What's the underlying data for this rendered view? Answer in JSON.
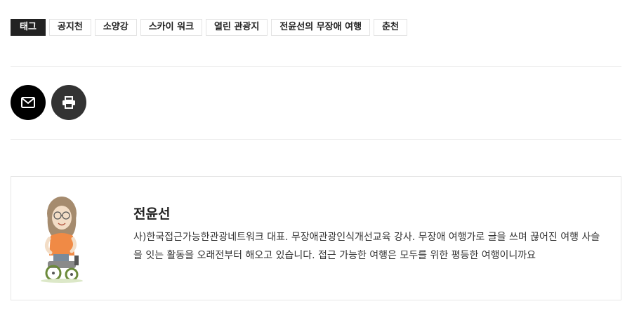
{
  "tags": {
    "label": "태그",
    "items": [
      "공지천",
      "소양강",
      "스카이 워크",
      "열린 관광지",
      "전윤선의 무장애 여행",
      "춘천"
    ]
  },
  "share": {
    "email_icon": "envelope-icon",
    "print_icon": "printer-icon"
  },
  "author": {
    "name": "전윤선",
    "bio": "사)한국접근가능한관광네트워크 대표. 무장애관광인식개선교육 강사. 무장애 여행가로 글을 쓰며 끊어진 여행 사슬을 잇는 활동을 오래전부터 해오고 있습니다. 접근 가능한 여행은 모두를 위한 평등한 여행이니까요"
  }
}
